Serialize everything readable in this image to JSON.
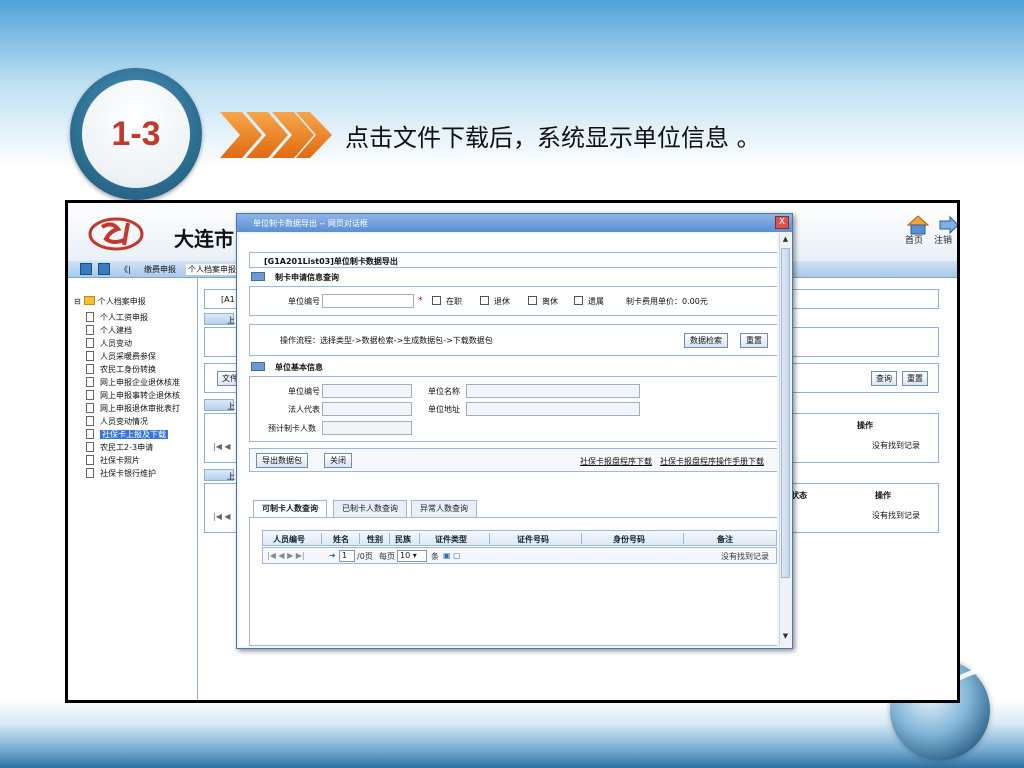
{
  "slide": {
    "step": "1-3",
    "headline": "点击文件下载后，系统显示单位信息 。"
  },
  "app": {
    "title": "大连市",
    "home_label": "首页",
    "logout_label": "注销",
    "nav_separator": "《|",
    "nav_item_1": "缴费申报",
    "nav_item_2": "个人档案申报"
  },
  "sidebar": {
    "root": "个人档案申报",
    "items": [
      {
        "label": "个人工资申报"
      },
      {
        "label": "个人建档"
      },
      {
        "label": "人员变动"
      },
      {
        "label": "人员采暖费参保"
      },
      {
        "label": "农民工身份转换"
      },
      {
        "label": "网上申报企业退休核准"
      },
      {
        "label": "网上申报事转企退休核"
      },
      {
        "label": "网上申报退休审批表打"
      },
      {
        "label": "人员变动情况"
      },
      {
        "label": "社保卡上报及下载"
      },
      {
        "label": "农民工2-3申请"
      },
      {
        "label": "社保卡照片"
      },
      {
        "label": "社保卡银行维护"
      }
    ]
  },
  "background": {
    "crumb_prefix": "[A1",
    "file_btn": "文件",
    "up_1": "上",
    "up_2": "上",
    "up_3": "上",
    "query_btn": "查询",
    "reset_btn": "重置",
    "op_header_1": "操作",
    "no_record_1": "没有找到记录",
    "status_header": "状态",
    "op_header_2": "操作",
    "no_record_2": "没有找到记录",
    "pager_glyph_1": "|◀ ◀",
    "pager_glyph_2": "|◀ ◀"
  },
  "dialog": {
    "title": "单位制卡数据导出 -- 网页对话框",
    "close": "X",
    "heading": "[G1A201List03]单位制卡数据导出",
    "query_section": {
      "title": "制卡申请信息查询",
      "unit_code_label": "单位编号",
      "required_mark": "*",
      "checkboxes": [
        "在职",
        "退休",
        "离休",
        "遗属"
      ],
      "fee_label": "制卡费用单价：0.00元"
    },
    "process": {
      "text": "操作流程：选择类型->数据检索->生成数据包->下载数据包",
      "search_btn": "数据检索",
      "reset_btn": "重置"
    },
    "unit_section": {
      "title": "单位基本信息",
      "unit_code_label": "单位编号",
      "unit_name_label": "单位名称",
      "legal_rep_label": "法人代表",
      "unit_addr_label": "单位地址",
      "expected_count_label": "预计制卡人数"
    },
    "actions": {
      "export_btn": "导出数据包",
      "close_btn": "关闭",
      "download_program": "社保卡报盘程序下载",
      "download_manual": "社保卡报盘程序操作手册下载"
    },
    "tabs": [
      "可制卡人数查询",
      "已制卡人数查询",
      "异常人数查询"
    ],
    "grid": {
      "columns": [
        "人员编号",
        "姓名",
        "性别",
        "民族",
        "证件类型",
        "证件号码",
        "身份号码",
        "备注"
      ],
      "pager": {
        "nav_glyphs": "|◀ ◀ ▶ ▶|",
        "refresh": "➜",
        "page_value": "1",
        "page_suffix": "/0页",
        "per_page_label": "每页",
        "per_page_value": "10",
        "per_page_suffix": "条",
        "no_record": "没有找到记录"
      }
    }
  },
  "colors": {
    "accent": "#5b8fd3",
    "badge_text": "#c0392b",
    "arrow": "#e87d1e"
  }
}
